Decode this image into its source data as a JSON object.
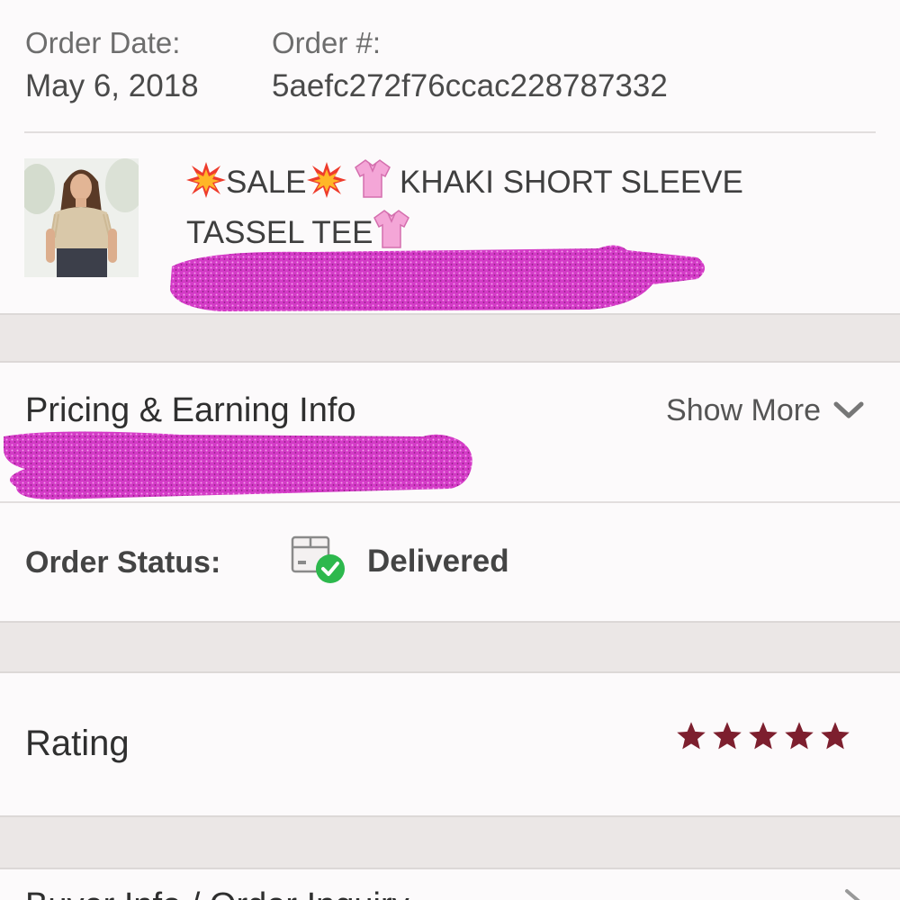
{
  "order": {
    "date_label": "Order Date:",
    "date_value": "May 6, 2018",
    "number_label": "Order #:",
    "number_value": "5aefc272f76ccac228787332"
  },
  "item": {
    "sale_text": "SALE",
    "title_line1": "KHAKI SHORT SLEEVE",
    "title_line2": "TASSEL TEE",
    "thumbnail_icon": "product-photo"
  },
  "pricing": {
    "title": "Pricing & Earning Info",
    "show_more_label": "Show More"
  },
  "status": {
    "label": "Order Status:",
    "value": "Delivered",
    "icon": "package-delivered-icon"
  },
  "rating": {
    "label": "Rating",
    "stars": 5,
    "max_stars": 5,
    "star_color": "#7d1f2e"
  },
  "bottom_row": {
    "label": "Buyer Info / Order Inquiry"
  },
  "colors": {
    "redaction": "#d43bc7",
    "accent_check": "#2db84d",
    "section_gap": "#ebe7e6"
  }
}
